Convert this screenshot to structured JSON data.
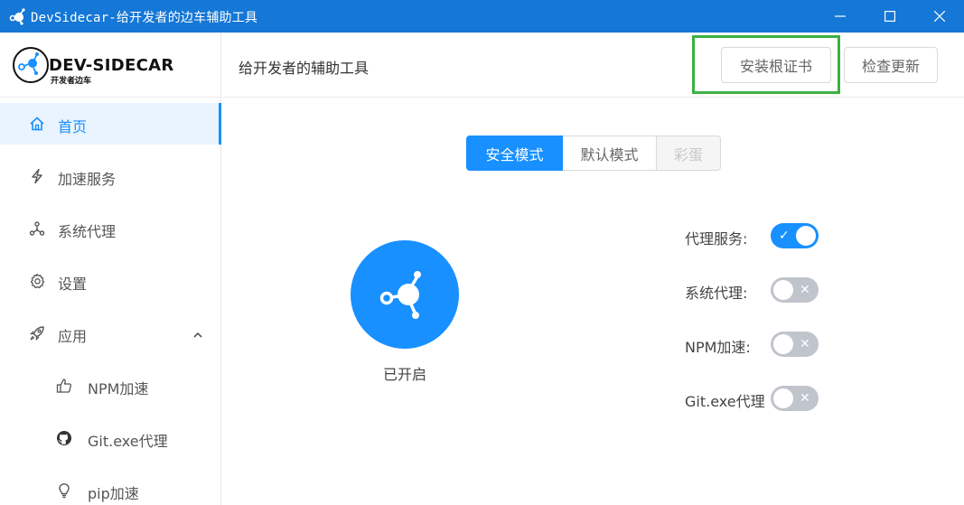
{
  "window": {
    "title": "DevSidecar-给开发者的边车辅助工具"
  },
  "logo": {
    "brand": "DEV-SIDECAR",
    "subtitle": "开发者边车"
  },
  "sidebar": {
    "items": [
      {
        "label": "首页",
        "icon": "home-icon",
        "active": true
      },
      {
        "label": "加速服务",
        "icon": "lightning-icon"
      },
      {
        "label": "系统代理",
        "icon": "network-icon"
      },
      {
        "label": "设置",
        "icon": "gear-icon"
      },
      {
        "label": "应用",
        "icon": "rocket-icon",
        "expanded": true
      },
      {
        "label": "NPM加速",
        "icon": "thumbs-up-icon"
      },
      {
        "label": "Git.exe代理",
        "icon": "github-icon"
      },
      {
        "label": "pip加速",
        "icon": "lightbulb-icon"
      }
    ]
  },
  "header": {
    "title": "给开发者的辅助工具",
    "install_cert_label": "安装根证书",
    "check_update_label": "检查更新"
  },
  "modes": {
    "safe": "安全模式",
    "default": "默认模式",
    "easter_egg": "彩蛋",
    "selected": "安全模式"
  },
  "status": {
    "label": "已开启"
  },
  "switches": [
    {
      "label": "代理服务:",
      "on": true,
      "mark": "✓"
    },
    {
      "label": "系统代理:",
      "on": false,
      "mark": "✕"
    },
    {
      "label": "NPM加速:",
      "on": false,
      "mark": "✕"
    },
    {
      "label": "Git.exe代理",
      "on": false,
      "mark": "✕"
    }
  ],
  "colors": {
    "accent": "#1890ff",
    "titlebar": "#1577d6",
    "highlight": "#3cb043"
  }
}
